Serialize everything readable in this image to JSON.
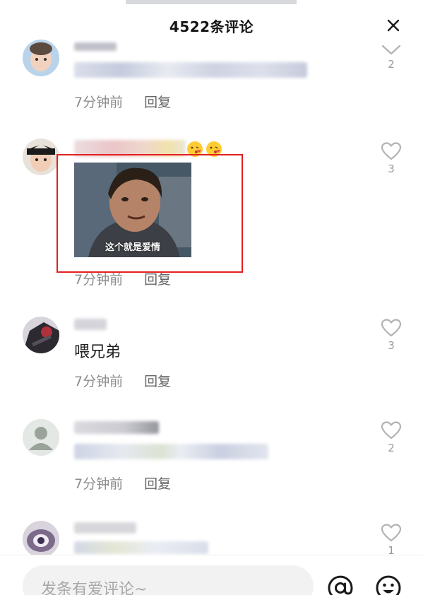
{
  "header": {
    "title": "4522条评论",
    "close_icon": "close-icon"
  },
  "comments": [
    {
      "text": "",
      "time": "7分钟前",
      "reply": "回复",
      "likes": "2",
      "like_icon": "chevron-down-icon"
    },
    {
      "text": "",
      "time": "7分钟前",
      "reply": "回复",
      "likes": "3",
      "like_icon": "heart-icon",
      "sticker_caption": "这个就是爱情"
    },
    {
      "text": "喂兄弟",
      "time": "7分钟前",
      "reply": "回复",
      "likes": "3",
      "like_icon": "heart-icon"
    },
    {
      "text": "",
      "time": "7分钟前",
      "reply": "回复",
      "likes": "2",
      "like_icon": "heart-icon"
    },
    {
      "text": "",
      "time": "",
      "reply": "",
      "likes": "1",
      "like_icon": "heart-icon"
    }
  ],
  "input": {
    "placeholder": "发条有爱评论~"
  },
  "colors": {
    "highlight": "#e32020",
    "muted": "#8c8c8c"
  }
}
